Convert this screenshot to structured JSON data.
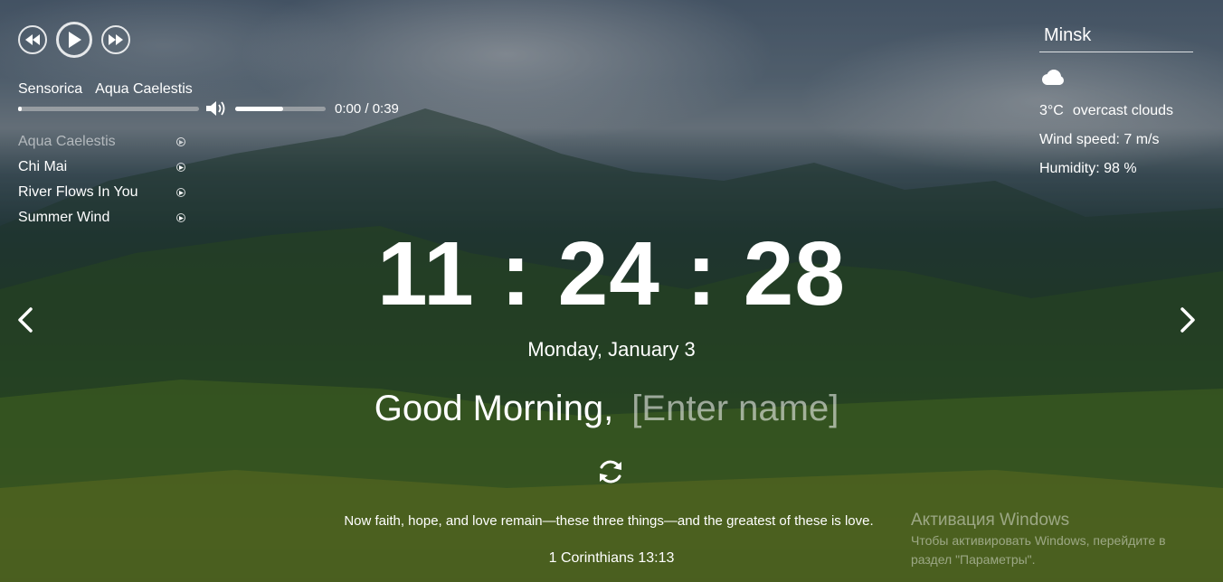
{
  "player": {
    "artist": "Sensorica",
    "track": "Aqua Caelestis",
    "progress": 0.02,
    "volume": 0.53,
    "time": "0:00 / 0:39",
    "playlist": [
      {
        "title": "Aqua Caelestis",
        "active": true
      },
      {
        "title": "Chi Mai",
        "active": false
      },
      {
        "title": "River Flows In You",
        "active": false
      },
      {
        "title": "Summer Wind",
        "active": false
      }
    ],
    "icons": {
      "prev": "rewind-icon",
      "play": "play-icon",
      "next": "fast-forward-icon",
      "volume": "volume-icon",
      "item": "play-small-icon"
    }
  },
  "weather": {
    "city": "Minsk",
    "icon": "cloud-icon",
    "temperature": "3°C",
    "description": "overcast clouds",
    "wind": "Wind speed: 7 m/s",
    "humidity": "Humidity: 98 %"
  },
  "clock": {
    "time": "11 : 24 : 28",
    "date": "Monday, January 3"
  },
  "greeting": {
    "text": "Good Morning,",
    "name_placeholder": "[Enter name]"
  },
  "quote": {
    "text": "Now faith, hope, and love remain—these three things—and the greatest of these is love.",
    "author": "1 Corinthians 13:13",
    "refresh_icon": "refresh-icon"
  },
  "slider": {
    "prev_icon": "chevron-left-icon",
    "next_icon": "chevron-right-icon"
  },
  "watermark": {
    "title": "Активация Windows",
    "line1": "Чтобы активировать Windows, перейдите в",
    "line2": "раздел \"Параметры\"."
  },
  "colors": {
    "text": "#ffffff",
    "muted": "#a0a4a8"
  }
}
